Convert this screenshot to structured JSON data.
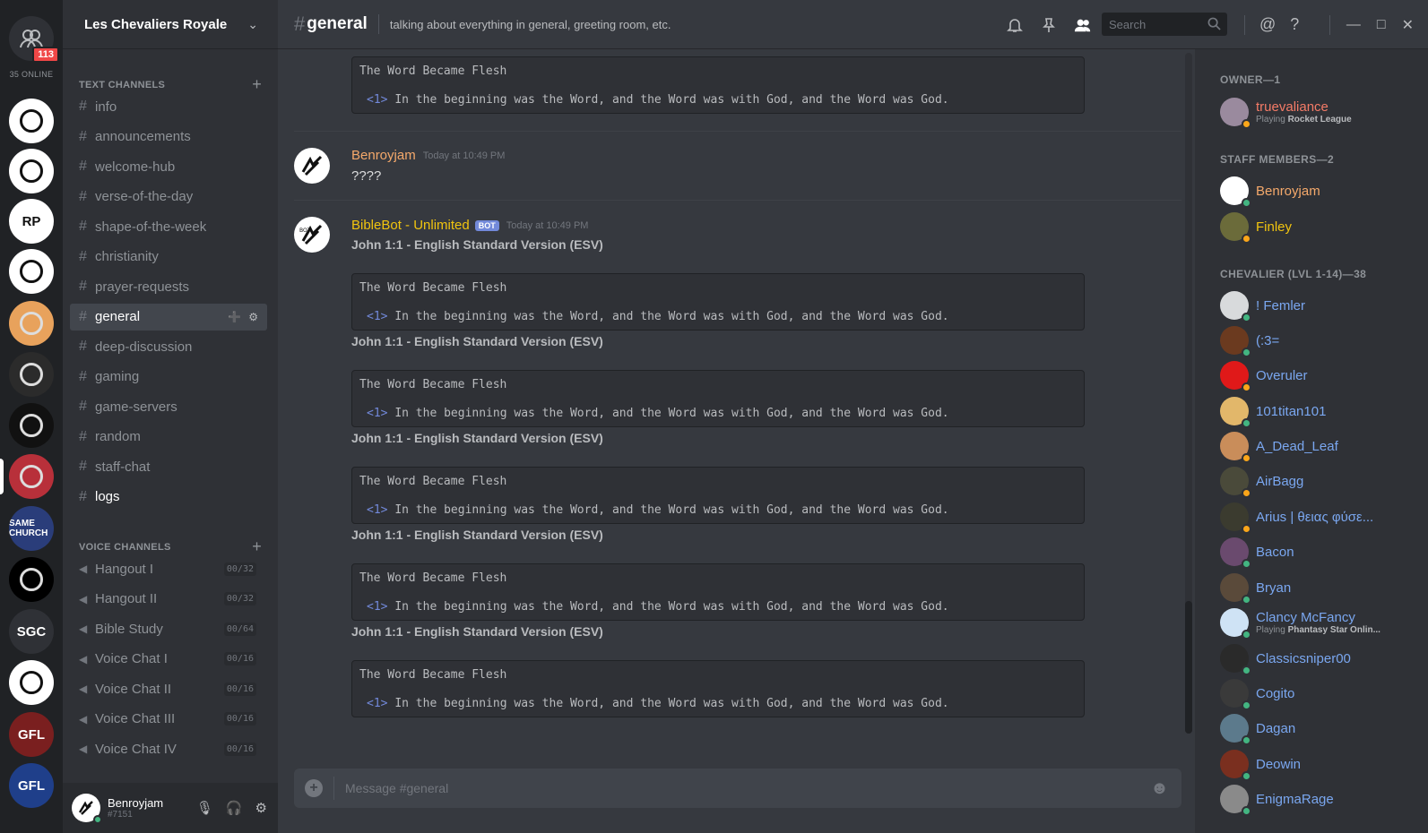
{
  "guilds": {
    "home_badge": "113",
    "online_count": "35 ONLINE",
    "servers": [
      {
        "name": "server-1",
        "label": "",
        "bg": "#ffffff"
      },
      {
        "name": "server-2",
        "label": "",
        "bg": "#ffffff"
      },
      {
        "name": "server-3",
        "label": "RP",
        "bg": "#ffffff"
      },
      {
        "name": "server-4",
        "label": "",
        "bg": "#ffffff"
      },
      {
        "name": "server-5",
        "label": "",
        "bg": "#e8a25c"
      },
      {
        "name": "server-6",
        "label": "",
        "bg": "#2b2b2b"
      },
      {
        "name": "server-7",
        "label": "",
        "bg": "#111111"
      },
      {
        "name": "server-8",
        "label": "",
        "bg": "#b8303a"
      },
      {
        "name": "server-9",
        "label": "SAME CHURCH",
        "bg": "#2a3d7a"
      },
      {
        "name": "server-10",
        "label": "",
        "bg": "#000000"
      },
      {
        "name": "server-11",
        "label": "SGC",
        "bg": "#2f3136"
      },
      {
        "name": "server-12",
        "label": "",
        "bg": "#ffffff"
      },
      {
        "name": "server-13",
        "label": "GFL",
        "bg": "#7a1f1f"
      },
      {
        "name": "server-14",
        "label": "GFL",
        "bg": "#1f3f8a"
      }
    ]
  },
  "server": {
    "name": "Les Chevaliers Royale"
  },
  "text_category": "TEXT CHANNELS",
  "voice_category": "VOICE CHANNELS",
  "text_channels": [
    "info",
    "announcements",
    "welcome-hub",
    "verse-of-the-day",
    "shape-of-the-week",
    "christianity",
    "prayer-requests",
    "general",
    "deep-discussion",
    "gaming",
    "game-servers",
    "random",
    "staff-chat",
    "logs"
  ],
  "voice_channels": [
    {
      "name": "Hangout I",
      "cap": "00/32"
    },
    {
      "name": "Hangout II",
      "cap": "00/32"
    },
    {
      "name": "Bible Study",
      "cap": "00/64"
    },
    {
      "name": "Voice Chat I",
      "cap": "00/16"
    },
    {
      "name": "Voice Chat II",
      "cap": "00/16"
    },
    {
      "name": "Voice Chat III",
      "cap": "00/16"
    },
    {
      "name": "Voice Chat IV",
      "cap": "00/16"
    }
  ],
  "user_panel": {
    "username": "Benroyjam",
    "tag": "#7151"
  },
  "header": {
    "hash": "#",
    "channel": "general",
    "topic": "talking about everything in general, greeting room, etc.",
    "search_placeholder": "Search"
  },
  "embed_text": {
    "title": "The Word Became Flesh",
    "verse_num": "<1>",
    "verse": "In the beginning was the Word, and the Word was with God, and the Word was God."
  },
  "messages": [
    {
      "author": "Benroyjam",
      "author_color": "#f5a96b",
      "timestamp": "Today at 10:49 PM",
      "text": "????"
    },
    {
      "author": "BibleBot - Unlimited",
      "author_color": "#f1c40f",
      "bot_badge": "BOT",
      "timestamp": "Today at 10:49 PM",
      "reference": "John 1:1 - English Standard Version (ESV)"
    }
  ],
  "composer": {
    "placeholder": "Message #general"
  },
  "members": {
    "categories": [
      "OWNER—1",
      "STAFF MEMBERS—2",
      "CHEVALIER (LVL 1-14)—38"
    ],
    "list": [
      {
        "name": "truevaliance",
        "color": "#f47b67",
        "status": "idle",
        "activity_prefix": "Playing ",
        "activity": "Rocket League",
        "ava": "#9a8a9e"
      },
      {
        "name": "Benroyjam",
        "color": "#f5a96b",
        "status": "online",
        "ava": "#ffffff"
      },
      {
        "name": "Finley",
        "color": "#f1c40f",
        "status": "idle",
        "ava": "#6b6b3a"
      },
      {
        "name": "! Femler",
        "color": "#7aa7f0",
        "status": "online",
        "ava": "#d8dadc"
      },
      {
        "name": "(:3=",
        "color": "#7aa7f0",
        "status": "online",
        "ava": "#6b3a1f"
      },
      {
        "name": "Overuler",
        "color": "#7aa7f0",
        "status": "idle",
        "ava": "#e01919"
      },
      {
        "name": "101titan101",
        "color": "#7aa7f0",
        "status": "online",
        "ava": "#e2b76a"
      },
      {
        "name": "A_Dead_Leaf",
        "color": "#7aa7f0",
        "status": "idle",
        "ava": "#c98d5a"
      },
      {
        "name": "AirBagg",
        "color": "#7aa7f0",
        "status": "idle",
        "ava": "#4a4a3a"
      },
      {
        "name": "Arius | θειας φύσε...",
        "color": "#7aa7f0",
        "status": "idle",
        "ava": "#3b3b2f"
      },
      {
        "name": "Bacon",
        "color": "#7aa7f0",
        "status": "online",
        "ava": "#6a4a6e"
      },
      {
        "name": "Bryan",
        "color": "#7aa7f0",
        "status": "online",
        "ava": "#5a4a3a"
      },
      {
        "name": "Clancy McFancy",
        "color": "#7aa7f0",
        "status": "online",
        "activity_prefix": "Playing ",
        "activity": "Phantasy Star Onlin...",
        "ava": "#cfe3f5"
      },
      {
        "name": "Classicsniper00",
        "color": "#7aa7f0",
        "status": "online",
        "ava": "#2a2a2a"
      },
      {
        "name": "Cogito",
        "color": "#7aa7f0",
        "status": "online",
        "ava": "#3a3a3a"
      },
      {
        "name": "Dagan",
        "color": "#7aa7f0",
        "status": "online",
        "ava": "#5c7a8c"
      },
      {
        "name": "Deowin",
        "color": "#7aa7f0",
        "status": "online",
        "ava": "#7a2f1f"
      },
      {
        "name": "EnigmaRage",
        "color": "#7aa7f0",
        "status": "online",
        "ava": "#8a8a8a"
      }
    ]
  },
  "colors": {
    "online": "#43b581",
    "idle": "#faa61a",
    "blurple": "#7289da"
  }
}
